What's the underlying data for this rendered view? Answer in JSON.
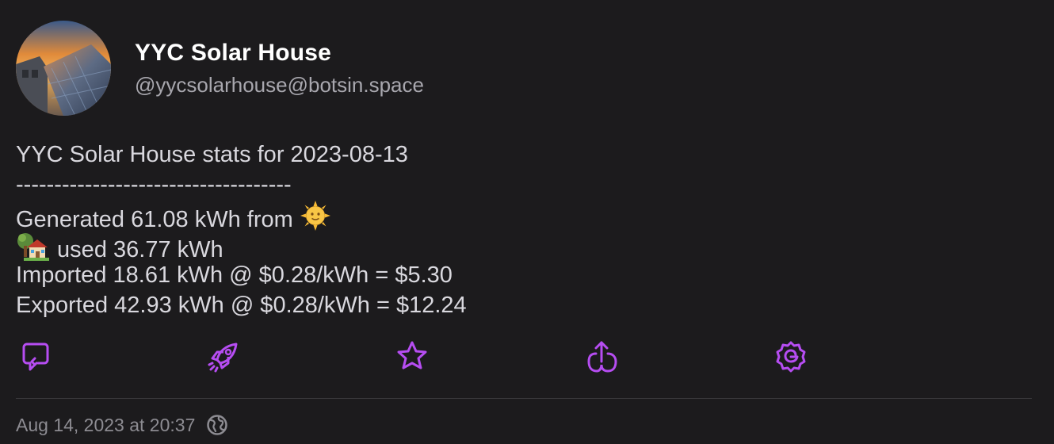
{
  "author": {
    "display_name": "YYC Solar House",
    "handle": "@yycsolarhouse@botsin.space"
  },
  "content": {
    "line1": "YYC Solar House stats for 2023-08-13",
    "line2": "------------------------------------",
    "line3": "Generated 61.08 kWh from ",
    "line3_emoji": "sun-with-face",
    "line4_emoji": "house-with-garden",
    "line4": " used 36.77 kWh",
    "line5": "Imported 18.61 kWh @ $0.28/kWh = $5.30",
    "line6": "Exported 42.93 kWh @ $0.28/kWh = $12.24"
  },
  "actions": [
    {
      "name": "reply",
      "icon": "reply-icon"
    },
    {
      "name": "boost",
      "icon": "rocket-icon"
    },
    {
      "name": "favourite",
      "icon": "star-icon"
    },
    {
      "name": "share",
      "icon": "share-icon"
    },
    {
      "name": "more",
      "icon": "gear-icon"
    }
  ],
  "timestamp": "Aug 14, 2023 at 20:37",
  "visibility_icon": "globe-icon",
  "colors": {
    "background": "#1c1b1d",
    "accent": "#b64df2",
    "text": "#d9d8de",
    "muted": "#8d8c92"
  }
}
